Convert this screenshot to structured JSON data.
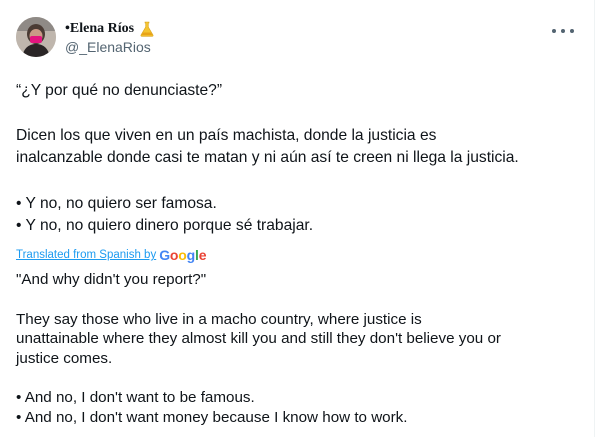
{
  "author": {
    "display_name": "•Elena Ríos",
    "handle": "@_ElenaRios",
    "badge_icon": "lab-flask-emoji-icon",
    "badge_color": "#f4c430"
  },
  "menu_icon": "more-horizontal-icon",
  "tweet": {
    "question": "“¿Y por qué no denunciaste?”",
    "paragraph": [
      "Dicen los que viven en un país machista, donde la justicia es",
      "inalcanzable donde casi te matan y ni aún así te creen ni llega la justicia."
    ],
    "bullets": [
      "• Y no, no quiero ser famosa.",
      "• Y no, no quiero dinero porque sé trabajar."
    ]
  },
  "translation_credit": {
    "label": "Translated from Spanish by",
    "provider": [
      "G",
      "o",
      "o",
      "g",
      "l",
      "e"
    ],
    "provider_colors": [
      "#4285f4",
      "#ea4335",
      "#fbbc05",
      "#4285f4",
      "#34a853",
      "#ea4335"
    ]
  },
  "translation": {
    "question": "\"And why didn't you report?\"",
    "paragraph": [
      "They say those who live in a macho country, where justice is",
      "unattainable where they almost kill you and still they don't believe you or",
      "justice comes."
    ],
    "bullets": [
      "• And no, I don't want to be famous.",
      "• And no, I don't want money because I know how to work."
    ]
  },
  "colors": {
    "text": "#0f1419",
    "secondary": "#536471",
    "link": "#1d9bf0"
  }
}
